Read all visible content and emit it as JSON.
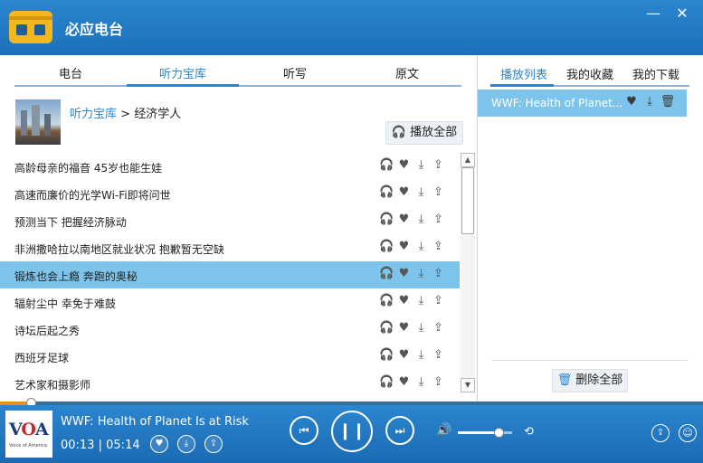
{
  "app": {
    "title": "必应电台"
  },
  "tabs": [
    {
      "label": "电台"
    },
    {
      "label": "听力宝库"
    },
    {
      "label": "听写"
    },
    {
      "label": "原文"
    }
  ],
  "breadcrumb": {
    "root": "听力宝库",
    "sep": ">",
    "current": "经济学人"
  },
  "play_all_label": "播放全部",
  "list": [
    {
      "title": "高龄母亲的福音 45岁也能生娃"
    },
    {
      "title": "高速而廉价的光学Wi-Fi即将问世"
    },
    {
      "title": "预测当下 把握经济脉动"
    },
    {
      "title": "非洲撒哈拉以南地区就业状况 抱歉暂无空缺"
    },
    {
      "title": "锻炼也会上瘾 奔跑的奥秘",
      "selected": true
    },
    {
      "title": "辐射尘中 幸免于难鼓"
    },
    {
      "title": "诗坛后起之秀"
    },
    {
      "title": "西班牙足球"
    },
    {
      "title": "艺术家和摄影师"
    }
  ],
  "right_tabs": [
    {
      "label": "播放列表"
    },
    {
      "label": "我的收藏"
    },
    {
      "label": "我的下载"
    }
  ],
  "playlist": [
    {
      "title": "WWF: Health of Planet..."
    }
  ],
  "delete_all_label": "删除全部",
  "player": {
    "title": "WWF: Health of Planet Is at Risk",
    "elapsed": "00:13",
    "total": "05:14",
    "time_sep": "|",
    "progress": 0.044,
    "volume": 0.75
  },
  "voa_logo": {
    "text": "VOA",
    "sub": "Voice of America"
  },
  "colors": {
    "accent": "#2b86cf",
    "selected_row": "#7cc4ec",
    "progress": "#ef8a1d"
  }
}
